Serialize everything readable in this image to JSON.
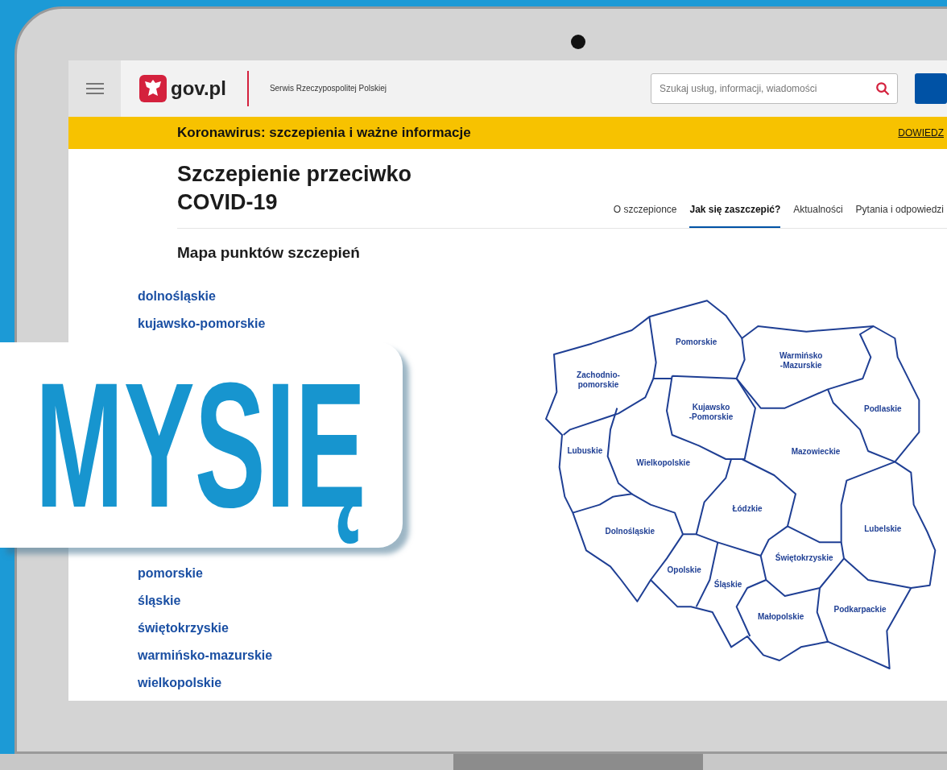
{
  "header": {
    "logo_text": "gov.pl",
    "service_name": "Serwis Rzeczypospolitej Polskiej",
    "search": {
      "placeholder": "Szukaj usług, informacji, wiadomości"
    }
  },
  "banner": {
    "text": "Koronawirus: szczepienia i ważne informacje",
    "link": "DOWIEDZ"
  },
  "page_title": "Szczepienie przeciwko COVID-19",
  "tabs": [
    {
      "label": "O szczepionce",
      "selected": false
    },
    {
      "label": "Jak się zaszczepić?",
      "selected": true
    },
    {
      "label": "Aktualności",
      "selected": false
    },
    {
      "label": "Pytania i odpowiedzi",
      "selected": false
    }
  ],
  "section_title": "Mapa punktów szczepień",
  "region_links": {
    "upper": [
      "dolnośląskie",
      "kujawsko-pomorskie"
    ],
    "lower": [
      "pomorskie",
      "śląskie",
      "świętokrzyskie",
      "warmińsko-mazurskie",
      "wielkopolskie"
    ]
  },
  "map": {
    "regions": [
      {
        "lines": [
          "Pomorskie"
        ]
      },
      {
        "lines": [
          "Warmińsko",
          "-Mazurskie"
        ]
      },
      {
        "lines": [
          "Zachodnio-",
          "pomorskie"
        ]
      },
      {
        "lines": [
          "Kujawsko",
          "-Pomorskie"
        ]
      },
      {
        "lines": [
          "Podlaskie"
        ]
      },
      {
        "lines": [
          "Lubuskie"
        ]
      },
      {
        "lines": [
          "Wielkopolskie"
        ]
      },
      {
        "lines": [
          "Mazowieckie"
        ]
      },
      {
        "lines": [
          "Łódzkie"
        ]
      },
      {
        "lines": [
          "Dolnośląskie"
        ]
      },
      {
        "lines": [
          "Lubelskie"
        ]
      },
      {
        "lines": [
          "Świętokrzyskie"
        ]
      },
      {
        "lines": [
          "Opolskie"
        ]
      },
      {
        "lines": [
          "Śląskie"
        ]
      },
      {
        "lines": [
          "Podkarpackie"
        ]
      },
      {
        "lines": [
          "Małopolskie"
        ]
      }
    ]
  },
  "overlay": {
    "text": "MYSIĘ"
  }
}
